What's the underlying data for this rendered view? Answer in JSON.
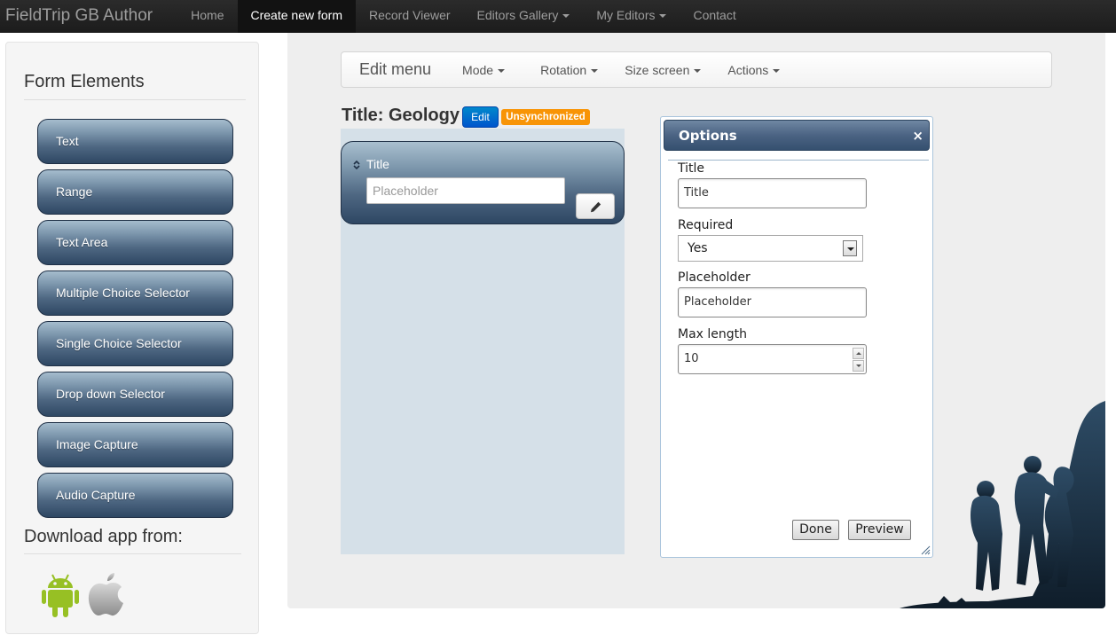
{
  "navbar": {
    "brand": "FieldTrip GB Author",
    "items": [
      {
        "label": "Home"
      },
      {
        "label": "Create new form"
      },
      {
        "label": "Record Viewer"
      },
      {
        "label": "Editors Gallery"
      },
      {
        "label": "My Editors"
      },
      {
        "label": "Contact"
      }
    ]
  },
  "sidebar": {
    "title": "Form Elements",
    "elements": [
      {
        "label": "Text"
      },
      {
        "label": "Range"
      },
      {
        "label": "Text Area"
      },
      {
        "label": "Multiple Choice Selector"
      },
      {
        "label": "Single Choice Selector"
      },
      {
        "label": "Drop down Selector"
      },
      {
        "label": "Image Capture"
      },
      {
        "label": "Audio Capture"
      }
    ],
    "download_title": "Download app from:",
    "download_icons": [
      "android-icon",
      "apple-icon"
    ]
  },
  "edit_menu": {
    "title": "Edit menu",
    "items": [
      {
        "label": "Mode"
      },
      {
        "label": "Rotation"
      },
      {
        "label": "Size screen"
      },
      {
        "label": "Actions"
      }
    ]
  },
  "form": {
    "title": "Title: Geology",
    "edit_label": "Edit",
    "status": "Unsynchronized",
    "field": {
      "label": "Title",
      "placeholder": "Placeholder"
    }
  },
  "options": {
    "title": "Options",
    "close": "×",
    "title_label": "Title",
    "title_value": "Title",
    "required_label": "Required",
    "required_value": "Yes",
    "placeholder_label": "Placeholder",
    "placeholder_value": "Placeholder",
    "maxlength_label": "Max length",
    "maxlength_value": "10",
    "done_label": "Done",
    "preview_label": "Preview"
  },
  "colors": {
    "navbar": "#222222",
    "element_button": "#4e6782",
    "edit_button": "#0066cc",
    "status_badge": "#f89406",
    "preview_bg": "#d5e0e8"
  }
}
